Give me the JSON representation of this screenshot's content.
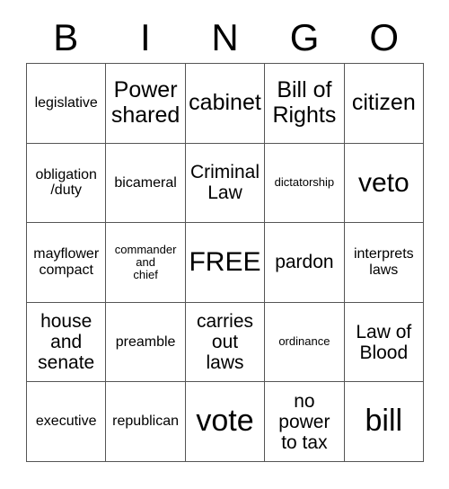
{
  "card": {
    "header": {
      "letters": [
        "B",
        "I",
        "N",
        "G",
        "O"
      ]
    },
    "free_space_label": "FREE",
    "colors": {
      "background": "#ffffff",
      "text": "#000000",
      "grid_line": "#555555"
    },
    "rows": [
      [
        {
          "text": "legislative",
          "size": "sm"
        },
        {
          "text": "Power\nshared",
          "size": "lg"
        },
        {
          "text": "cabinet",
          "size": "lg"
        },
        {
          "text": "Bill of\nRights",
          "size": "lg"
        },
        {
          "text": "citizen",
          "size": "lg"
        }
      ],
      [
        {
          "text": "obligation\n/duty",
          "size": "sm"
        },
        {
          "text": "bicameral",
          "size": "sm"
        },
        {
          "text": "Criminal\nLaw",
          "size": "md"
        },
        {
          "text": "dictatorship",
          "size": "xs"
        },
        {
          "text": "veto",
          "size": "xl"
        }
      ],
      [
        {
          "text": "mayflower\ncompact",
          "size": "sm"
        },
        {
          "text": "commander\nand\nchief",
          "size": "xs"
        },
        {
          "text": "FREE",
          "size": "xl"
        },
        {
          "text": "pardon",
          "size": "md"
        },
        {
          "text": "interprets\nlaws",
          "size": "sm"
        }
      ],
      [
        {
          "text": "house\nand\nsenate",
          "size": "md"
        },
        {
          "text": "preamble",
          "size": "sm"
        },
        {
          "text": "carries\nout\nlaws",
          "size": "md"
        },
        {
          "text": "ordinance",
          "size": "xs"
        },
        {
          "text": "Law of\nBlood",
          "size": "md"
        }
      ],
      [
        {
          "text": "executive",
          "size": "sm"
        },
        {
          "text": "republican",
          "size": "sm"
        },
        {
          "text": "vote",
          "size": "xxl"
        },
        {
          "text": "no\npower\nto tax",
          "size": "md"
        },
        {
          "text": "bill",
          "size": "xxl"
        }
      ]
    ]
  }
}
